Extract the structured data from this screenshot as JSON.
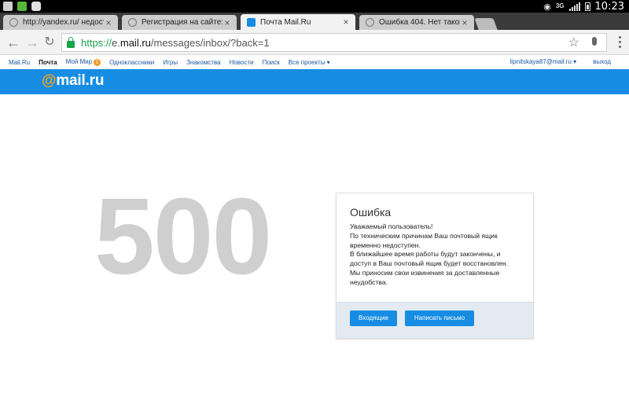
{
  "status_bar": {
    "network": "3G",
    "clock": "10:23"
  },
  "browser": {
    "tabs": [
      {
        "title": "http://yandex.ru/ недосту",
        "active": false
      },
      {
        "title": "Регистрация на сайте:",
        "active": false
      },
      {
        "title": "Почта Mail.Ru",
        "active": true
      },
      {
        "title": "Ошибка 404. Нет такой",
        "active": false
      }
    ],
    "address_bar": {
      "scheme": "https://",
      "prefix": "e.",
      "domain": "mail.ru",
      "path": "/messages/inbox/?back=1"
    }
  },
  "portal_nav": {
    "items": [
      {
        "label": "Mail.Ru",
        "current": false
      },
      {
        "label": "Почта",
        "current": true
      },
      {
        "label": "Мой Мир",
        "current": false,
        "badge": "1"
      },
      {
        "label": "Одноклассники",
        "current": false
      },
      {
        "label": "Игры",
        "current": false
      },
      {
        "label": "Знакомства",
        "current": false
      },
      {
        "label": "Новости",
        "current": false
      },
      {
        "label": "Поиск",
        "current": false
      },
      {
        "label": "Все проекты ▾",
        "current": false
      }
    ],
    "user_email": "lipnitskaya87@mail.ru ▾",
    "logout": "выход"
  },
  "header": {
    "logo_at": "@",
    "logo_text": "mail.ru"
  },
  "error_page": {
    "code": "500",
    "title": "Ошибка",
    "lines": [
      "Уважаемый пользователь!",
      "По техническим причинам Ваш почтовый ящик",
      "временно недоступен.",
      "В ближайшее время работы будут закончены, и",
      "доступ в Ваш почтовый ящик будет восстановлен.",
      "Мы приносим свои извинения за доставленные",
      "неудобства."
    ],
    "buttons": {
      "inbox": "Входящие",
      "compose": "Написать письмо"
    }
  },
  "colors": {
    "brand_blue": "#168de2",
    "brand_orange": "#f7a21c",
    "error_gray": "#cfcfcf"
  }
}
